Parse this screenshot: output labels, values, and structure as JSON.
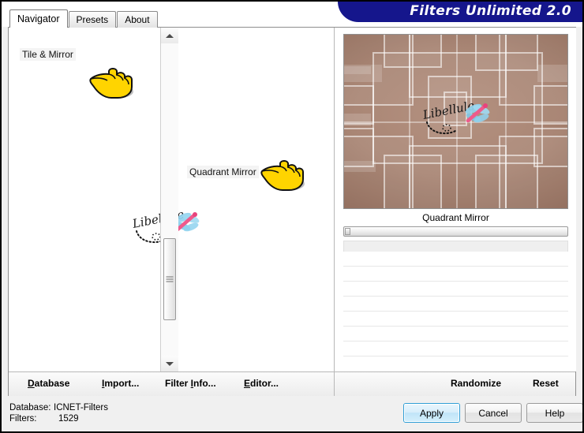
{
  "window": {
    "title": "Filters Unlimited 2.0",
    "banner_color": "#15168c"
  },
  "tabs": [
    {
      "label": "Navigator",
      "active": true
    },
    {
      "label": "Presets",
      "active": false
    },
    {
      "label": "About",
      "active": false
    }
  ],
  "navigator": {
    "category": "Tile & Mirror",
    "filter": "Quadrant Mirror",
    "watermark": "Libellule",
    "cursor_icon": "pointing-hand-icon",
    "scrollbar": {
      "up_icon": "scroll-up-arrow-icon",
      "down_icon": "scroll-down-arrow-icon"
    }
  },
  "preview": {
    "label": "Quadrant Mirror",
    "watermark": "Libellule",
    "base_color": "#a47f6d"
  },
  "function_bar": {
    "database": {
      "pre": "D",
      "post": "atabase"
    },
    "import": {
      "pre": "I",
      "post": "mport..."
    },
    "filter_info": {
      "pre_plain": "Filter ",
      "pre": "I",
      "post": "nfo..."
    },
    "editor": {
      "pre": "E",
      "post": "ditor..."
    },
    "randomize": "Randomize",
    "reset": "Reset"
  },
  "status": {
    "database_label": "Database:",
    "database_value": "ICNET-Filters",
    "filters_label": "Filters:",
    "filters_value": "1529"
  },
  "dialog_buttons": {
    "apply": "Apply",
    "cancel": "Cancel",
    "help": "Help"
  }
}
